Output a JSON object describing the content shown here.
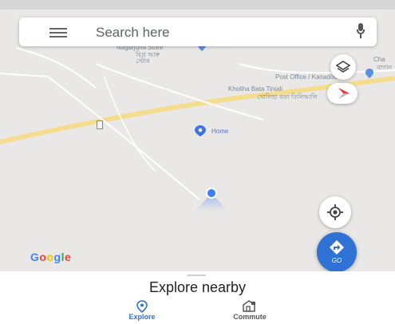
{
  "search": {
    "placeholder": "Search here"
  },
  "map_labels": {
    "place_top_1": "Nagarjuna Store",
    "place_top_2": "বিগ্ৰ আৰু",
    "place_top_3": "স্টোৰ",
    "post_office": "Post Office / Kanadoor",
    "road_label_en": "Kholiha Bata Tiniali",
    "road_label_as": "খোলিহা বতা তিনিআলি",
    "right_edge_1": "Cha",
    "right_edge_2": "বাগান",
    "home_label": "Home"
  },
  "brand": {
    "logo_text": "Google"
  },
  "go_button": {
    "label": "GO"
  },
  "bottom_sheet": {
    "title": "Explore nearby"
  },
  "nav": {
    "explore": "Explore",
    "commute": "Commute"
  },
  "colors": {
    "accent": "#2f72d6",
    "road_major": "#f7e3a1",
    "map_bg": "#e9e8e6",
    "compass_red": "#e53935"
  }
}
